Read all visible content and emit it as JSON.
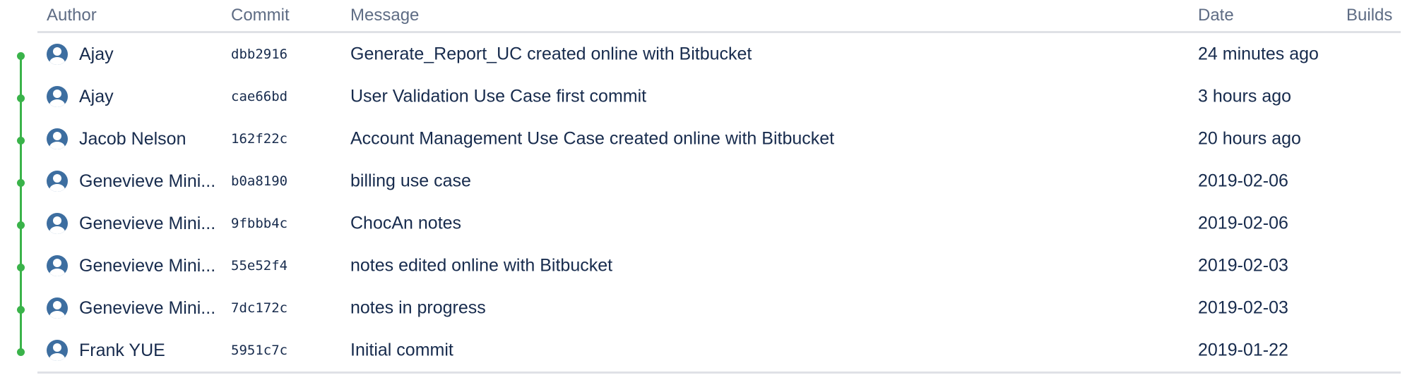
{
  "headers": {
    "author": "Author",
    "commit": "Commit",
    "message": "Message",
    "date": "Date",
    "builds": "Builds"
  },
  "commits": [
    {
      "author": "Ajay",
      "hash": "dbb2916",
      "message": "Generate_Report_UC created online with Bitbucket",
      "date": "24 minutes ago"
    },
    {
      "author": "Ajay",
      "hash": "cae66bd",
      "message": "User Validation Use Case first commit",
      "date": "3 hours ago"
    },
    {
      "author": "Jacob Nelson",
      "hash": "162f22c",
      "message": "Account Management Use Case created online with Bitbucket",
      "date": "20 hours ago"
    },
    {
      "author": "Genevieve Mini...",
      "hash": "b0a8190",
      "message": "billing use case",
      "date": "2019-02-06"
    },
    {
      "author": "Genevieve Mini...",
      "hash": "9fbbb4c",
      "message": "ChocAn notes",
      "date": "2019-02-06"
    },
    {
      "author": "Genevieve Mini...",
      "hash": "55e52f4",
      "message": "notes edited online with Bitbucket",
      "date": "2019-02-03"
    },
    {
      "author": "Genevieve Mini...",
      "hash": "7dc172c",
      "message": "notes in progress",
      "date": "2019-02-03"
    },
    {
      "author": "Frank YUE",
      "hash": "5951c7c",
      "message": "Initial commit",
      "date": "2019-01-22"
    }
  ],
  "colors": {
    "graph": "#3ab34a",
    "avatar": "#3d6ea0",
    "header_text": "#5e6c84",
    "text": "#172b4d",
    "divider": "#dfe1e6"
  },
  "icons": {
    "avatar": "default-user-avatar-icon",
    "graph_node": "commit-graph-dot"
  }
}
